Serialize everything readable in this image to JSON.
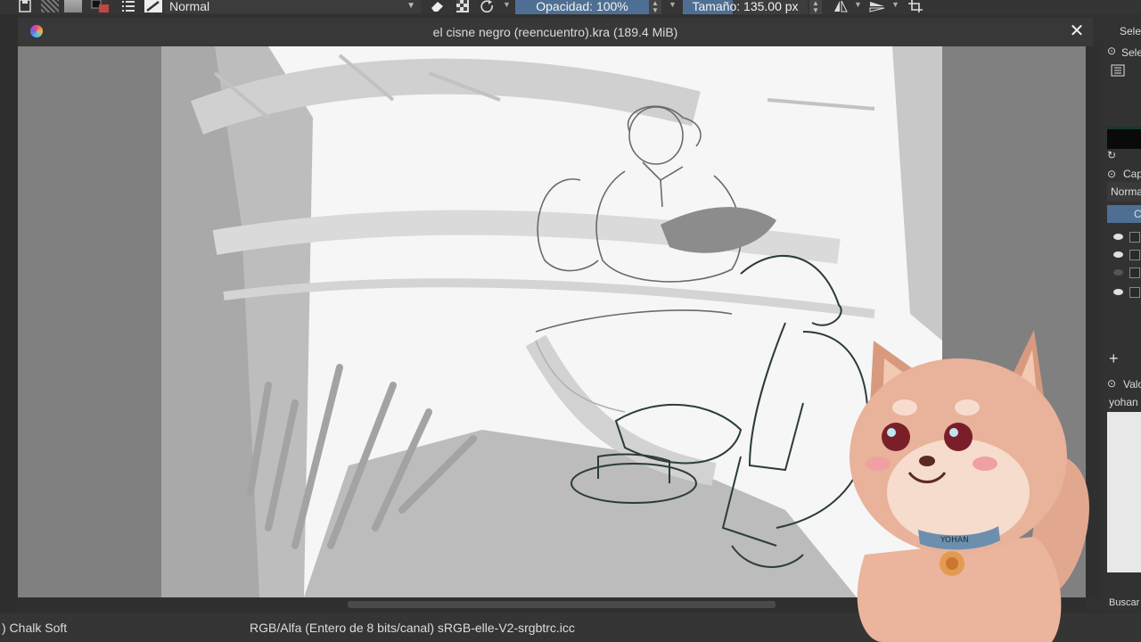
{
  "toolbar": {
    "blend_mode": "Normal",
    "opacity": "Opacidad: 100%",
    "opacity_level": 1.0,
    "size": "Tamaño: 135.00 px",
    "size_level": 0.4,
    "icons": [
      "save-icon",
      "pattern-icon",
      "gradient-icon",
      "color-swap-icon",
      "list-icon",
      "brush-preset-icon",
      "eraser-icon",
      "alpha-lock-icon",
      "reload-icon",
      "mirror-horizontal-icon",
      "mirror-vertical-icon",
      "wrap-icon"
    ]
  },
  "document": {
    "title": "el cisne negro (reencuentro).kra (189.4 MiB)"
  },
  "status": {
    "brush": ") Chalk Soft",
    "colorspace": "RGB/Alfa (Entero de 8 bits/canal)  sRGB-elle-V2-srgbtrc.icc"
  },
  "dock": {
    "selector_header": "Selec",
    "selector_tab": "Sele",
    "layers_header": "Cap",
    "layers_blend": "Norma",
    "layers_tab": "C",
    "brush_header": "Valo",
    "brush_search": "yohan",
    "search_label": "Buscar"
  },
  "mascot": {
    "collar_text": "YOHAN"
  },
  "colors": {
    "accent": "#4e6f93",
    "background": "#313131",
    "canvas_bg": "#808080"
  }
}
